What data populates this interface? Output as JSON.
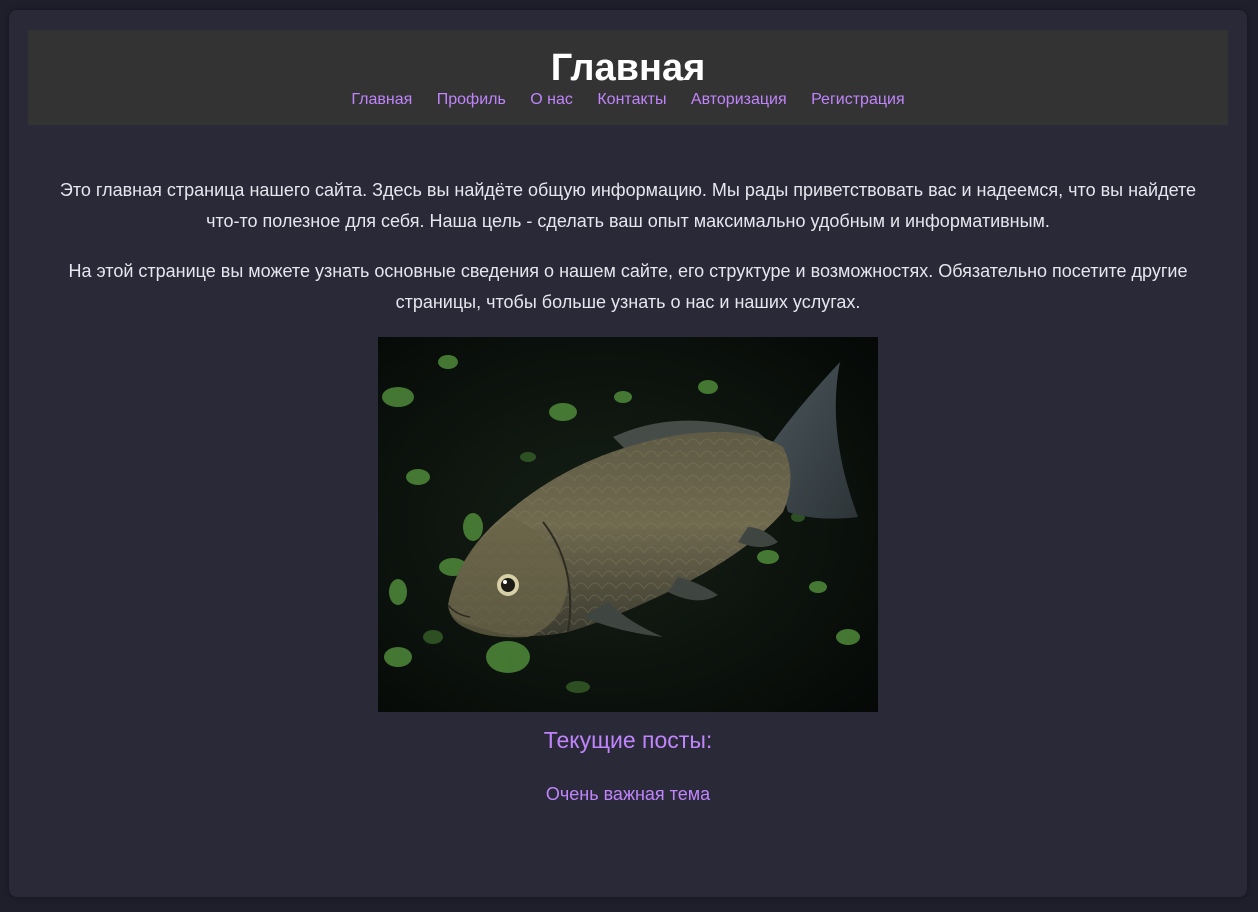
{
  "header": {
    "title": "Главная",
    "nav": [
      {
        "label": "Главная"
      },
      {
        "label": "Профиль"
      },
      {
        "label": "О нас"
      },
      {
        "label": "Контакты"
      },
      {
        "label": "Авторизация"
      },
      {
        "label": "Регистрация"
      }
    ]
  },
  "main": {
    "paragraphs": [
      "Это главная страница нашего сайта. Здесь вы найдёте общую информацию. Мы рады приветствовать вас и надеемся, что вы найдете что-то полезное для себя. Наша цель - сделать ваш опыт максимально удобным и информативным.",
      "На этой странице вы можете узнать основные сведения о нашем сайте, его структуре и возможностях. Обязательно посетите другие страницы, чтобы больше узнать о нас и наших услугах."
    ],
    "posts_heading": "Текущие посты:",
    "posts": [
      {
        "title": "Очень важная тема"
      }
    ]
  },
  "colors": {
    "page_background": "#1f1e2b",
    "card_background": "#2a2938",
    "header_background": "#333333",
    "link_accent": "#c084fc",
    "body_text": "#e6e6ee"
  }
}
